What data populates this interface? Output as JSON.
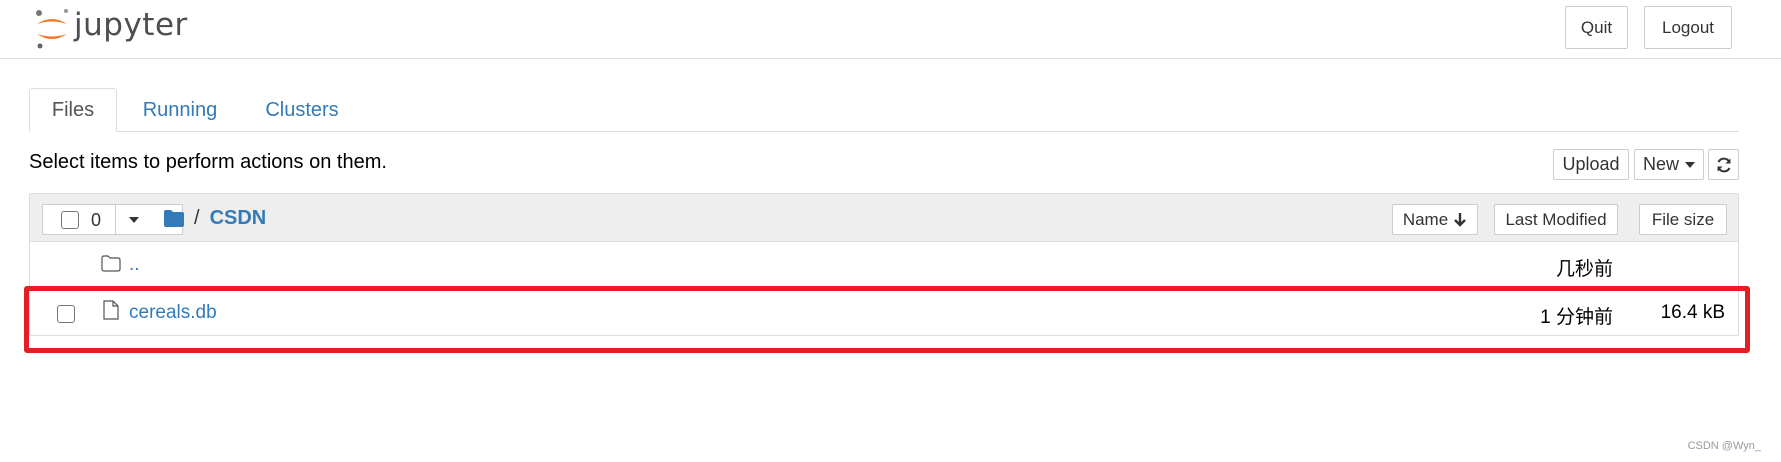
{
  "app": {
    "logo_text": "jupyter",
    "quit_label": "Quit",
    "logout_label": "Logout"
  },
  "tabs": [
    {
      "label": "Files",
      "active": true
    },
    {
      "label": "Running",
      "active": false
    },
    {
      "label": "Clusters",
      "active": false
    }
  ],
  "toolbar": {
    "instructions": "Select items to perform actions on them.",
    "upload_label": "Upload",
    "new_label": "New",
    "refresh_icon": "refresh-icon"
  },
  "list_header": {
    "selected_count": "0",
    "breadcrumb_sep": "/",
    "breadcrumb_current": "CSDN",
    "sort_name_label": "Name",
    "sort_modified_label": "Last Modified",
    "sort_size_label": "File size"
  },
  "items": [
    {
      "name": "..",
      "icon": "folder-icon",
      "modified": "几秒前",
      "size": ""
    },
    {
      "name": "cereals.db",
      "icon": "file-icon",
      "modified": "1 分钟前",
      "size": "16.4 kB"
    }
  ],
  "watermark": "CSDN @Wyn_",
  "colors": {
    "link": "#337ab7",
    "highlight": "#e41e26",
    "logo_orange": "#f37726",
    "header_bg": "#eeeeee"
  }
}
